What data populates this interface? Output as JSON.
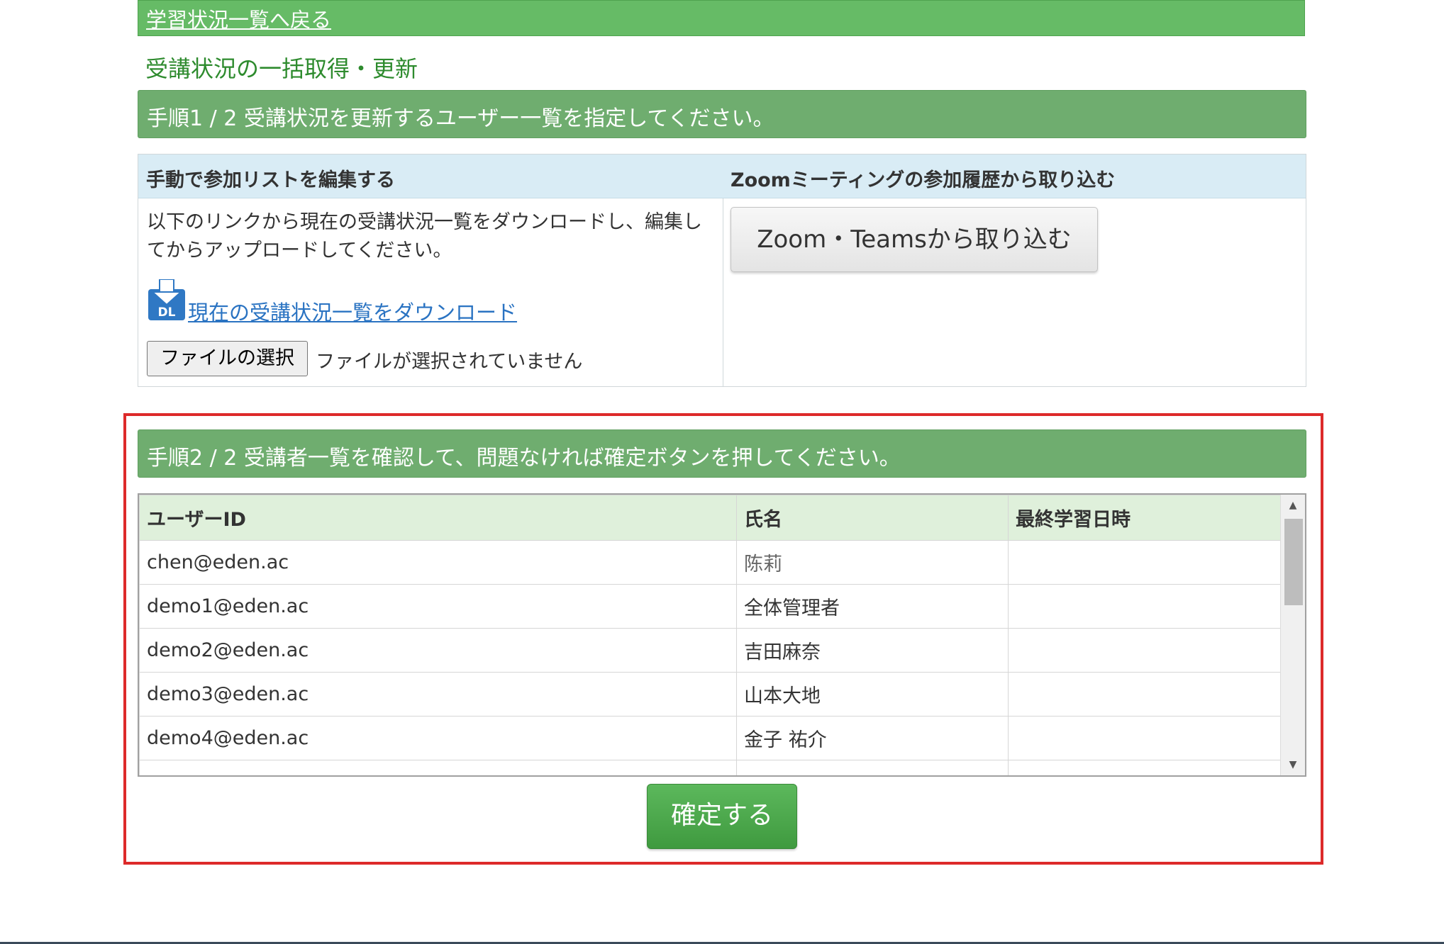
{
  "nav": {
    "back_link": "学習状況一覧へ戻る"
  },
  "page": {
    "title": "受講状況の一括取得・更新"
  },
  "step1": {
    "title": "手順1 / 2 受講状況を更新するユーザー一覧を指定してください。",
    "manual": {
      "header": "手動で参加リストを編集する",
      "description": "以下のリンクから現在の受講状況一覧をダウンロードし、編集してからアップロードしてください。",
      "download_link": "現在の受講状況一覧をダウンロード",
      "dl_icon_label": "DL",
      "file_button": "ファイルの選択",
      "file_status": "ファイルが選択されていません"
    },
    "zoom": {
      "header": "Zoomミーティングの参加履歴から取り込む",
      "import_button": "Zoom・Teamsから取り込む"
    }
  },
  "step2": {
    "title": "手順2 / 2 受講者一覧を確認して、問題なければ確定ボタンを押してください。",
    "table": {
      "columns": [
        "ユーザーID",
        "氏名",
        "最終学習日時"
      ],
      "rows": [
        {
          "user_id": "chen@eden.ac",
          "name": "陈莉",
          "last": ""
        },
        {
          "user_id": "demo1@eden.ac",
          "name": "全体管理者",
          "last": ""
        },
        {
          "user_id": "demo2@eden.ac",
          "name": "吉田麻奈",
          "last": ""
        },
        {
          "user_id": "demo3@eden.ac",
          "name": "山本大地",
          "last": ""
        },
        {
          "user_id": "demo4@eden.ac",
          "name": "金子 祐介",
          "last": ""
        }
      ]
    },
    "confirm_button": "確定する"
  },
  "colors": {
    "topbar": "#66bb66",
    "step_bar": "#6fad6f",
    "panel_head": "#d9ecf5",
    "table_head": "#dff0db",
    "highlight_frame": "#dd2a2a",
    "link": "#2a73c2",
    "confirm": "#4caf50"
  }
}
